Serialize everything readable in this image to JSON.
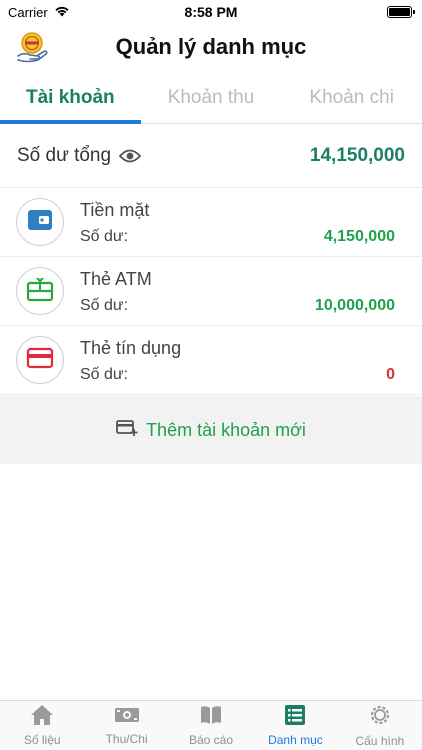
{
  "status_bar": {
    "carrier": "Carrier",
    "time": "8:58 PM"
  },
  "header": {
    "title": "Quản lý danh mục"
  },
  "tabs": [
    {
      "label": "Tài khoản",
      "active": true
    },
    {
      "label": "Khoản thu",
      "active": false
    },
    {
      "label": "Khoản chi",
      "active": false
    }
  ],
  "total": {
    "label": "Số dư tổng",
    "value": "14,150,000"
  },
  "accounts": [
    {
      "name": "Tiền mặt",
      "balance_label": "Số dư:",
      "balance": "4,150,000",
      "icon": "wallet-icon",
      "color": "#2f7fc1",
      "balance_color": "#1fa24a"
    },
    {
      "name": "Thẻ ATM",
      "balance_label": "Số dư:",
      "balance": "10,000,000",
      "icon": "atm-card-icon",
      "color": "#28a745",
      "balance_color": "#1fa24a"
    },
    {
      "name": "Thẻ tín dụng",
      "balance_label": "Số dư:",
      "balance": "0",
      "icon": "credit-card-icon",
      "color": "#e02b3c",
      "balance_color": "#e02b3c"
    }
  ],
  "add_account": {
    "label": "Thêm tài khoản mới"
  },
  "bottom_nav": [
    {
      "label": "Số liệu",
      "icon": "home-icon",
      "active": false
    },
    {
      "label": "Thu/Chi",
      "icon": "money-icon",
      "active": false
    },
    {
      "label": "Báo cáo",
      "icon": "book-icon",
      "active": false
    },
    {
      "label": "Danh mục",
      "icon": "list-icon",
      "active": true
    },
    {
      "label": "Cấu hình",
      "icon": "settings-icon",
      "active": false
    }
  ],
  "colors": {
    "accent_green": "#1a7f64",
    "tab_indicator": "#1f7ae0",
    "positive": "#1fa24a",
    "negative": "#e02b3c"
  }
}
